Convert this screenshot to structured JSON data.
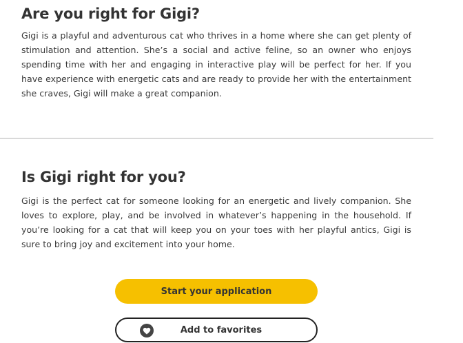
{
  "section1": {
    "title": "Are you right for Gigi?",
    "body": "Gigi is a playful and adventurous cat who thrives in a home where she can get plenty of stimulation and attention. She’s a social and active feline, so an owner who enjoys spending time with her and engaging in interactive play will be perfect for her. If you have experience with energetic cats and are ready to provide her with the entertainment she craves, Gigi will make a great companion."
  },
  "section2": {
    "title": "Is Gigi right for you?",
    "body": "Gigi is the perfect cat for someone looking for an energetic and lively companion. She loves to explore, play, and be involved in whatever’s happening in the household. If you’re looking for a cat that will keep you on your toes with her playful antics, Gigi is sure to bring joy and excitement into your home."
  },
  "actions": {
    "apply_label": "Start your application",
    "favorite_label": "Add to favorites",
    "favorite_icon": "heart-icon"
  },
  "colors": {
    "accent": "#f6c000",
    "text": "#333333",
    "divider": "#d9d9d9"
  }
}
